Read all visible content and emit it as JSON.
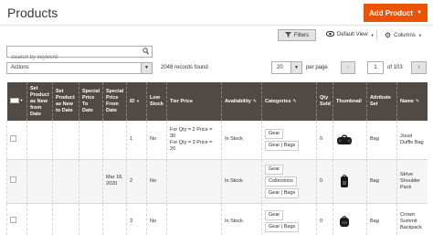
{
  "page": {
    "title": "Products"
  },
  "header": {
    "add_label": "Add Product"
  },
  "toolbar": {
    "filters_label": "Filters",
    "view_label": "Default View",
    "columns_label": "Columns"
  },
  "search": {
    "placeholder": "Search by keyword"
  },
  "actions": {
    "label": "Actions"
  },
  "records": "2048 records found",
  "pagination": {
    "per_page": "20",
    "per_page_label": "per page",
    "current_page": "1",
    "of_label": "of 103"
  },
  "columns": {
    "set_new_from": "Set Product as New from Date",
    "set_new_to": "Set Product as New to Date",
    "special_to": "Special Price To Date",
    "special_from": "Special Price From Date",
    "id": "ID",
    "low_stock": "Low Stock",
    "tier_price": "Tier Price",
    "availability": "Availability",
    "categories": "Categories",
    "qty_sold": "Qty Sold",
    "thumbnail": "Thumbnail",
    "attribute_set": "Attribute Set",
    "name": "Name"
  },
  "rows": [
    {
      "special_from": "",
      "id": "1",
      "low_stock": "No",
      "tier_1": "For Qty = 2 Price = 30",
      "tier_2": "For Qty = 3 Price = 20",
      "availability": "In Stock",
      "categories": [
        "Gear",
        "Gear | Bags"
      ],
      "qty_sold": "0",
      "thumbnail_icon": "duffle-bag-icon",
      "attribute_set": "Bag",
      "name": "Joust Duffle Bag"
    },
    {
      "special_from": "Mar 18, 2020",
      "id": "2",
      "low_stock": "No",
      "tier_1": "",
      "tier_2": "",
      "availability": "In Stock",
      "categories": [
        "Gear",
        "Collections",
        "Gear | Bags"
      ],
      "qty_sold": "0",
      "thumbnail_icon": "backpack-icon",
      "attribute_set": "Bag",
      "name": "Strive Shoulder Pack"
    },
    {
      "special_from": "",
      "id": "3",
      "low_stock": "No",
      "tier_1": "",
      "tier_2": "",
      "availability": "In Stock",
      "categories": [
        "Gear",
        "Gear | Bags"
      ],
      "qty_sold": "0",
      "thumbnail_icon": "backpack-icon",
      "attribute_set": "Bag",
      "name": "Crown Summit Backpack"
    }
  ],
  "colors": {
    "accent": "#eb5202",
    "header_bg": "#514943"
  }
}
